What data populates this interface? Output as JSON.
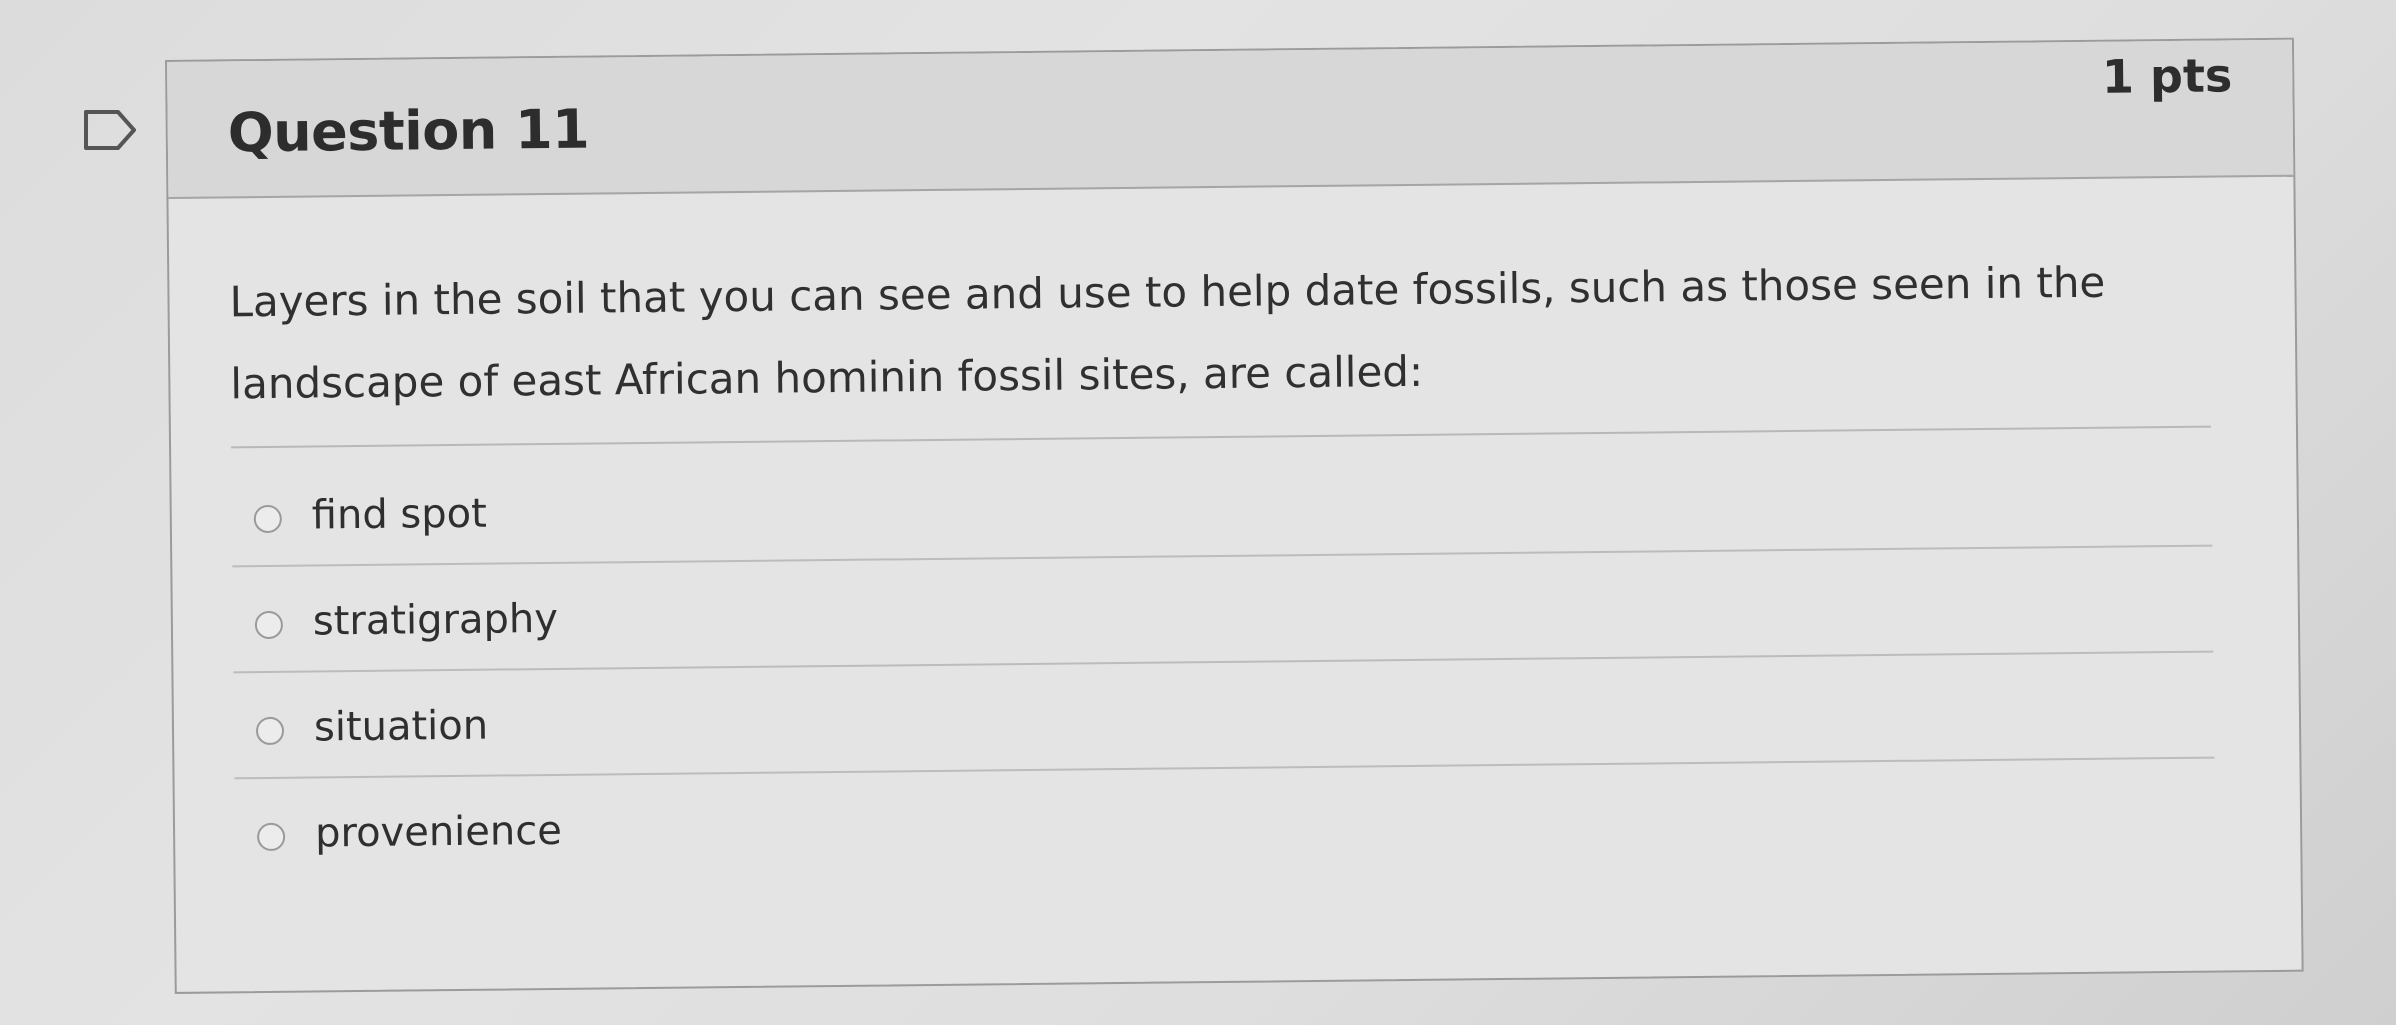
{
  "question": {
    "title": "Question 11",
    "points": "1 pts",
    "text": "Layers in the soil that you can see and use to help date fossils, such as those seen in the landscape of east African hominin fossil sites, are called:",
    "answers": [
      {
        "label": "find spot"
      },
      {
        "label": "stratigraphy"
      },
      {
        "label": "situation"
      },
      {
        "label": "provenience"
      }
    ]
  },
  "icons": {
    "bookmark": "bookmark-flag-icon",
    "radio": "radio-button-icon"
  },
  "colors": {
    "card_border": "#9b9b9b",
    "header_bg": "#d7d7d7",
    "text": "#2d2d2d"
  }
}
